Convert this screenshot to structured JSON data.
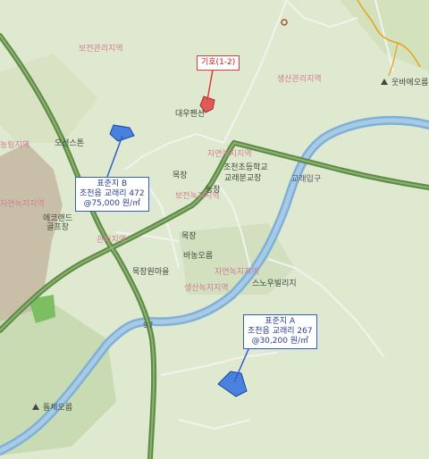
{
  "labels": {
    "district_1": "보전관리지역",
    "district_2": "생산관리지역",
    "district_3": "농림지역",
    "district_4": "자연녹지지역",
    "district_5": "보전녹지지역",
    "district_6": "자연녹지지역",
    "district_7": "생산녹지지역",
    "district_8": "자연녹지지역",
    "district_9": "관리지역",
    "place_1": "대우팬션",
    "place_2": "오션스톤",
    "place_3": "조천초등학교",
    "place_4": "교래분교장",
    "place_5": "에코랜드\n골프장",
    "place_6": "목장",
    "place_7": "농장",
    "place_8": "목장",
    "place_9": "목장원마을",
    "place_10": "스노우빌리지",
    "place_11": "웃바메오름",
    "place_12": "돌체오름",
    "place_13": "바농오름",
    "road_label": "교래입구",
    "road_num": "97"
  },
  "markers": [
    {
      "id": "target",
      "title": "기호(1-2)"
    },
    {
      "id": "std_b",
      "title": "표준지 B",
      "line2": "조천읍 교래리 472",
      "line3": "@75,000 원/㎡"
    },
    {
      "id": "std_a",
      "title": "표준지 A",
      "line2": "조천읍 교래리 267",
      "line3": "@30,200 원/㎡"
    }
  ],
  "colors": {
    "background": "#dfe9cf",
    "river": "#7fb0d6",
    "main_road": "#5e8a47",
    "parcel_fill": "#2f6fe0",
    "target_fill": "#e04a4a"
  }
}
